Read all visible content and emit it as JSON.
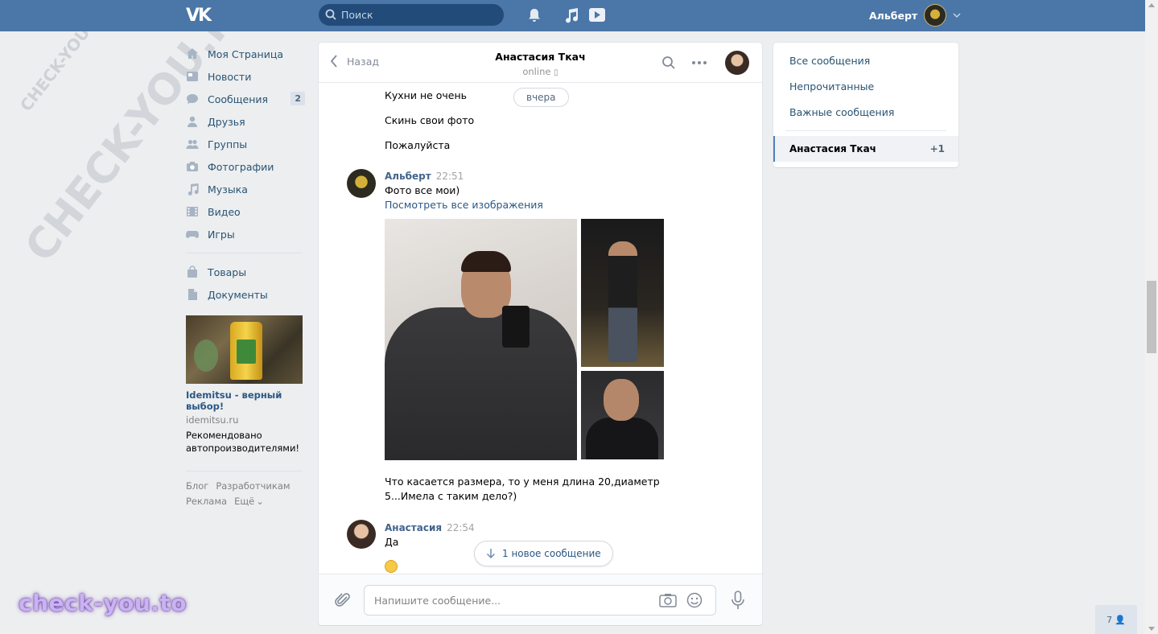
{
  "header": {
    "logo": "VK",
    "search_placeholder": "Поиск",
    "user_name": "Альберт"
  },
  "watermark": {
    "big": "CHECK-YOU.ME",
    "small": "CHECK-YOU.ME"
  },
  "sidebar": {
    "items": [
      {
        "label": "Моя Страница",
        "icon": "home-icon"
      },
      {
        "label": "Новости",
        "icon": "news-icon"
      },
      {
        "label": "Сообщения",
        "icon": "messages-icon",
        "badge": "2"
      },
      {
        "label": "Друзья",
        "icon": "friends-icon"
      },
      {
        "label": "Группы",
        "icon": "groups-icon"
      },
      {
        "label": "Фотографии",
        "icon": "camera-icon"
      },
      {
        "label": "Музыка",
        "icon": "music-icon"
      },
      {
        "label": "Видео",
        "icon": "video-icon"
      },
      {
        "label": "Игры",
        "icon": "gamepad-icon"
      }
    ],
    "items2": [
      {
        "label": "Товары",
        "icon": "bag-icon"
      },
      {
        "label": "Документы",
        "icon": "document-icon"
      }
    ],
    "ad": {
      "title": "Idemitsu - верный выбор!",
      "domain": "idemitsu.ru",
      "text": "Рекомендовано автопроизводителями!"
    },
    "footer": [
      "Блог",
      "Разработчикам",
      "Реклама",
      "Ещё"
    ]
  },
  "chat": {
    "back_label": "Назад",
    "peer_name": "Анастасия Ткач",
    "peer_status": "online",
    "date_pill": "вчера",
    "messages_before": [
      "Кухни не очень",
      "Скинь свои фото",
      "Пожалуйста"
    ],
    "msg1": {
      "author": "Альберт",
      "time": "22:51",
      "text": "Фото все мои)",
      "link": "Посмотреть все изображения",
      "text2": "Что касается размера, то у меня длина 20,диаметр 5...Имела с таким дело?)"
    },
    "msg2": {
      "author": "Анастасия",
      "time": "22:54",
      "text": "Да"
    },
    "new_messages": "1 новое сообщение",
    "input_placeholder": "Напишите сообщение..."
  },
  "right_panel": {
    "items": [
      "Все сообщения",
      "Непрочитанные",
      "Важные сообщения"
    ],
    "active_name": "Анастасия Ткач",
    "active_count": "+1"
  },
  "counter": "7",
  "brand": "check-you.to",
  "colors": {
    "header": "#4a76a8",
    "background": "#edeef0",
    "link": "#2a5885",
    "accent": "#5181b8"
  }
}
